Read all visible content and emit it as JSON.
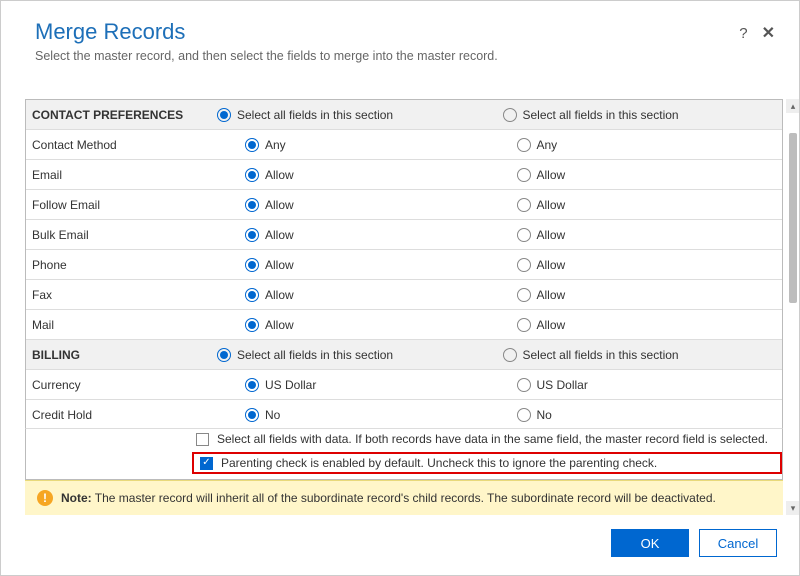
{
  "header": {
    "title": "Merge Records",
    "subtitle": "Select the master record, and then select the fields to merge into the master record."
  },
  "select_all_label": "Select all fields in this section",
  "sections": [
    {
      "name": "CONTACT PREFERENCES",
      "rows": [
        {
          "label": "Contact Method",
          "a": "Any",
          "b": "Any"
        },
        {
          "label": "Email",
          "a": "Allow",
          "b": "Allow"
        },
        {
          "label": "Follow Email",
          "a": "Allow",
          "b": "Allow"
        },
        {
          "label": "Bulk Email",
          "a": "Allow",
          "b": "Allow"
        },
        {
          "label": "Phone",
          "a": "Allow",
          "b": "Allow"
        },
        {
          "label": "Fax",
          "a": "Allow",
          "b": "Allow"
        },
        {
          "label": "Mail",
          "a": "Allow",
          "b": "Allow"
        }
      ]
    },
    {
      "name": "BILLING",
      "rows": [
        {
          "label": "Currency",
          "a": "US Dollar",
          "b": "US Dollar"
        },
        {
          "label": "Credit Hold",
          "a": "No",
          "b": "No"
        }
      ]
    }
  ],
  "checks": {
    "select_all_data": "Select all fields with data. If both records have data in the same field, the master record field is selected.",
    "parenting": "Parenting check is enabled by default. Uncheck this to ignore the parenting check."
  },
  "note": {
    "bold": "Note:",
    "text": " The master record will inherit all of the subordinate record's child records. The subordinate record will be deactivated."
  },
  "buttons": {
    "ok": "OK",
    "cancel": "Cancel"
  }
}
